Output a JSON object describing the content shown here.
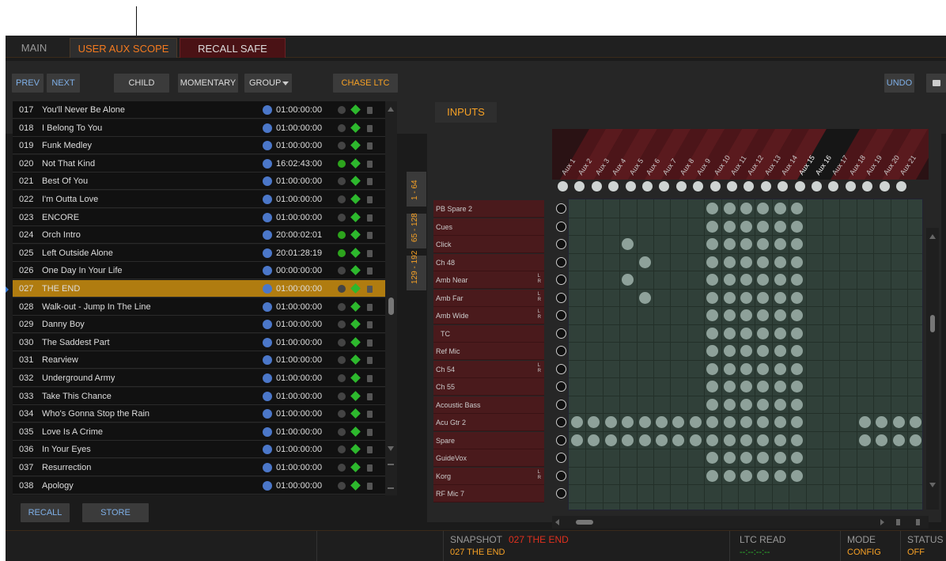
{
  "tabs": {
    "main": "MAIN",
    "user_aux_scope": "USER AUX SCOPE",
    "recall_safe": "RECALL SAFE"
  },
  "toolbar": {
    "prev": "PREV",
    "next": "NEXT",
    "child": "CHILD",
    "momentary": "MOMENTARY",
    "group": "GROUP",
    "chase": "CHASE LTC",
    "undo": "UNDO"
  },
  "rows": [
    {
      "num": "017",
      "name": "You'll Never Be Alone",
      "time": "01:00:00:00",
      "green": false
    },
    {
      "num": "018",
      "name": "I Belong To You",
      "time": "01:00:00:00",
      "green": false
    },
    {
      "num": "019",
      "name": "Funk Medley",
      "time": "01:00:00:00",
      "green": false
    },
    {
      "num": "020",
      "name": "Not That Kind",
      "time": "16:02:43:00",
      "green": true
    },
    {
      "num": "021",
      "name": "Best Of You",
      "time": "01:00:00:00",
      "green": false
    },
    {
      "num": "022",
      "name": "I'm Outta Love",
      "time": "01:00:00:00",
      "green": false
    },
    {
      "num": "023",
      "name": "ENCORE",
      "time": "01:00:00:00",
      "green": false
    },
    {
      "num": "024",
      "name": "Orch Intro",
      "time": "20:00:02:01",
      "green": true
    },
    {
      "num": "025",
      "name": "Left Outside Alone",
      "time": "20:01:28:19",
      "green": true
    },
    {
      "num": "026",
      "name": "One Day In Your Life",
      "time": "00:00:00:00",
      "green": false
    },
    {
      "num": "027",
      "name": "THE END",
      "time": "01:00:00:00",
      "green": false,
      "selected": true
    },
    {
      "num": "028",
      "name": "Walk-out - Jump In The Line",
      "time": "01:00:00:00",
      "green": false
    },
    {
      "num": "029",
      "name": "Danny Boy",
      "time": "01:00:00:00",
      "green": false
    },
    {
      "num": "030",
      "name": "The Saddest Part",
      "time": "01:00:00:00",
      "green": false
    },
    {
      "num": "031",
      "name": "Rearview",
      "time": "01:00:00:00",
      "green": false
    },
    {
      "num": "032",
      "name": "Underground Army",
      "time": "01:00:00:00",
      "green": false
    },
    {
      "num": "033",
      "name": "Take This Chance",
      "time": "01:00:00:00",
      "green": false
    },
    {
      "num": "034",
      "name": "Who's Gonna Stop the Rain",
      "time": "01:00:00:00",
      "green": false
    },
    {
      "num": "035",
      "name": "Love Is A Crime",
      "time": "01:00:00:00",
      "green": false
    },
    {
      "num": "036",
      "name": "In Your Eyes",
      "time": "01:00:00:00",
      "green": false
    },
    {
      "num": "037",
      "name": "Resurrection",
      "time": "01:00:00:00",
      "green": false
    },
    {
      "num": "038",
      "name": "Apology",
      "time": "01:00:00:00",
      "green": false
    }
  ],
  "side_tabs": [
    "1 - 64",
    "65 - 128",
    "129 - 192"
  ],
  "bottom_buttons": {
    "recall": "RECALL",
    "store": "STORE"
  },
  "inputs_tab": "INPUTS",
  "aux": [
    "Aux 1",
    "Aux 2",
    "Aux 3",
    "Aux 4",
    "Aux 5",
    "Aux 6",
    "Aux 7",
    "Aux 8",
    "Aux 9",
    "Aux 10",
    "Aux 11",
    "Aux 12",
    "Aux 13",
    "Aux 14",
    "Aux 15",
    "Aux 16",
    "Aux 17",
    "Aux 18",
    "Aux 19",
    "Aux 20",
    "Aux 21"
  ],
  "inputs": [
    {
      "name": "PB Spare 2",
      "lr": false
    },
    {
      "name": "Cues",
      "lr": false
    },
    {
      "name": "Click",
      "lr": false
    },
    {
      "name": "Ch 48",
      "lr": false
    },
    {
      "name": "Amb Near",
      "lr": true
    },
    {
      "name": "Amb Far",
      "lr": true
    },
    {
      "name": "Amb Wide",
      "lr": true
    },
    {
      "name": "TC",
      "lr": false
    },
    {
      "name": "Ref Mic",
      "lr": false
    },
    {
      "name": "Ch 54",
      "lr": true
    },
    {
      "name": "Ch 55",
      "lr": false
    },
    {
      "name": "Acoustic Bass",
      "lr": false
    },
    {
      "name": "Acu Gtr 2",
      "lr": false
    },
    {
      "name": "Spare",
      "lr": false
    },
    {
      "name": "GuideVox",
      "lr": false
    },
    {
      "name": "Korg",
      "lr": true
    },
    {
      "name": "RF Mic 7",
      "lr": false
    }
  ],
  "lr_label": {
    "l": "L",
    "r": "R"
  },
  "status": {
    "snapshot_title": "SNAPSHOT",
    "snapshot_current": "027 THE END",
    "snapshot_value": "027 THE END",
    "ltc_title": "LTC READ",
    "ltc_value": "--:--:--:--",
    "mode_title": "MODE",
    "mode_value": "CONFIG",
    "status_title": "STATUS",
    "status_value": "OFF"
  },
  "colors": {
    "accent": "#f47a1f",
    "selected_row": "#b07c10",
    "input_label_bg": "#4a1a1c",
    "grid_bg": "#304039",
    "dot": "#8ea19a"
  }
}
